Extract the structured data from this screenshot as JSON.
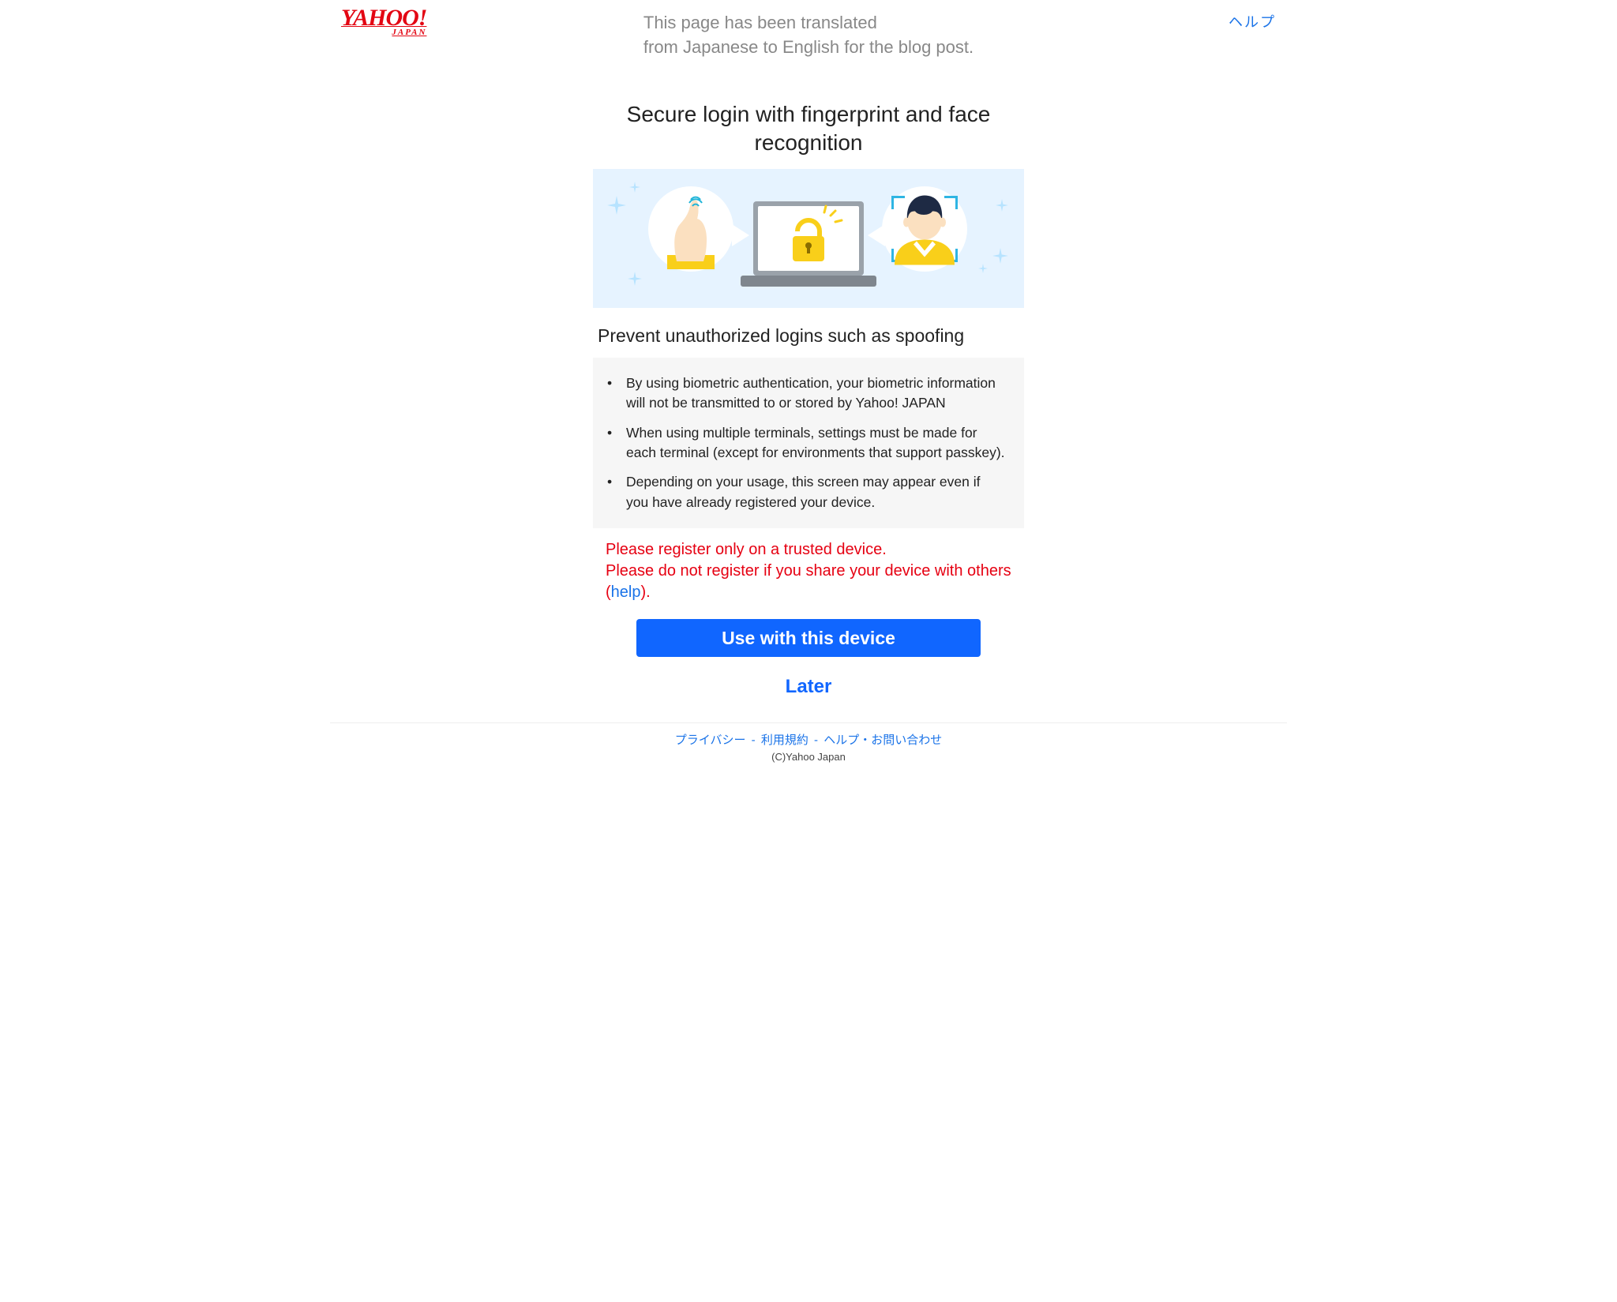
{
  "header": {
    "logo_main": "YAHOO!",
    "logo_sub": "JAPAN",
    "translated_note": "This page has been translated\nfrom Japanese to English for the blog post.",
    "help_label": "ヘルプ"
  },
  "main": {
    "headline": "Secure login with fingerprint and face recognition",
    "subhead": "Prevent unauthorized logins such as spoofing",
    "bullets": [
      "By using biometric authentication, your biometric information will not be transmitted to or stored by Yahoo! JAPAN",
      "When using multiple terminals, settings must be made for each terminal (except for environments that support passkey).",
      "Depending on your usage, this screen may appear even if you have already registered your device."
    ],
    "warning_line1": "Please register only on a trusted device.",
    "warning_line2_pre": "Please do not register if you share your device with others (",
    "warning_help": "help",
    "warning_line2_post": ").",
    "primary_button": "Use with this device",
    "later_link": "Later"
  },
  "footer": {
    "links": [
      "プライバシー",
      "利用規約",
      "ヘルプ・お問い合わせ"
    ],
    "copyright": "(C)Yahoo Japan"
  },
  "colors": {
    "brand_red": "#e30613",
    "link_blue": "#1a73e8",
    "primary_blue": "#1066ff",
    "error_red": "#e60012",
    "hero_bg": "#e6f3ff"
  }
}
